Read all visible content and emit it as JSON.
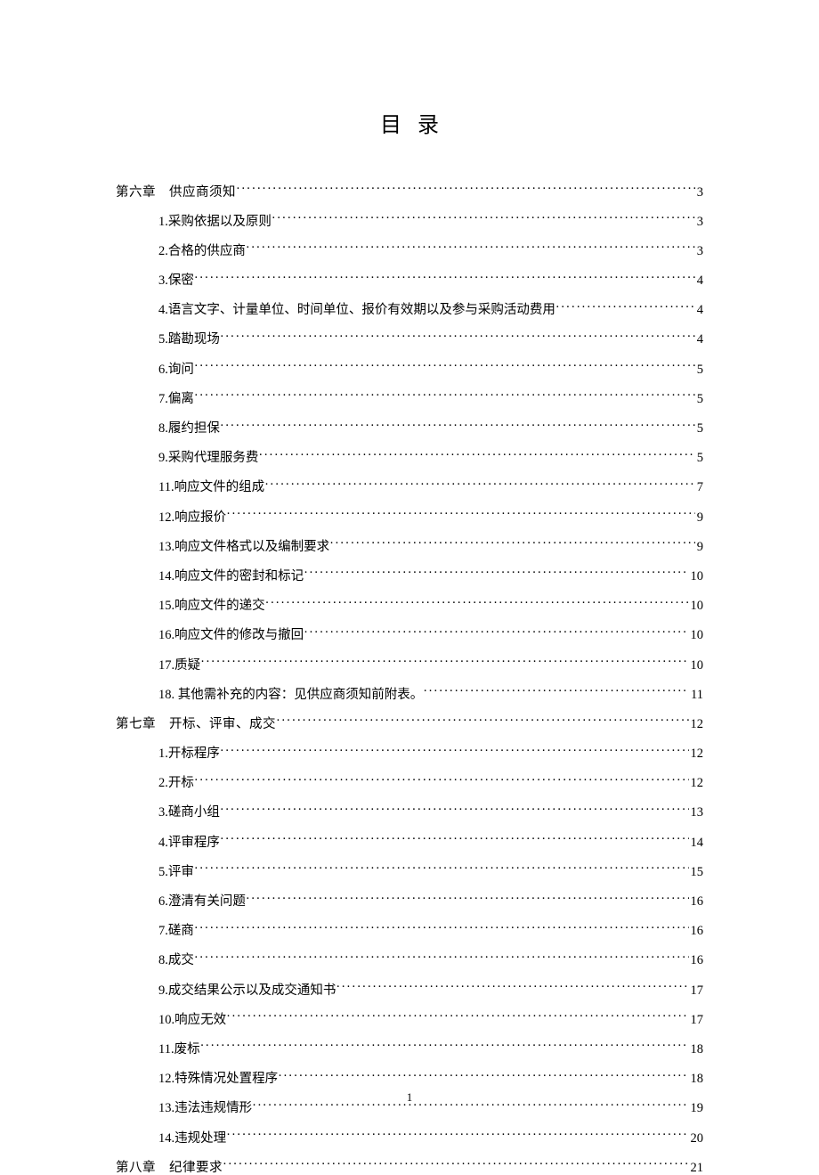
{
  "title": "目录",
  "page_number": "1",
  "entries": [
    {
      "level": "chapter",
      "label_prefix": "第六章",
      "label_text": "供应商须知",
      "page": "3"
    },
    {
      "level": "item",
      "num": "1.",
      "text": "采购依据以及原则",
      "page": "3"
    },
    {
      "level": "item",
      "num": "2.",
      "text": "合格的供应商",
      "page": "3"
    },
    {
      "level": "item",
      "num": "3.",
      "text": "保密",
      "page": "4"
    },
    {
      "level": "item",
      "num": "4.",
      "text": "语言文字、计量单位、时间单位、报价有效期以及参与采购活动费用",
      "page": "4"
    },
    {
      "level": "item",
      "num": "5.",
      "text": "踏勘现场",
      "page": "4"
    },
    {
      "level": "item",
      "num": "6.",
      "text": "询问",
      "page": "5"
    },
    {
      "level": "item",
      "num": "7.",
      "text": "偏离",
      "page": "5"
    },
    {
      "level": "item",
      "num": "8.",
      "text": "履约担保",
      "page": "5"
    },
    {
      "level": "item",
      "num": "9.",
      "text": "采购代理服务费",
      "page": "5"
    },
    {
      "level": "item",
      "num": "11.",
      "text": "响应文件的组成",
      "page": "7"
    },
    {
      "level": "item",
      "num": "12.",
      "text": "响应报价",
      "page": "9"
    },
    {
      "level": "item",
      "num": "13.",
      "text": "响应文件格式以及编制要求",
      "page": "9"
    },
    {
      "level": "item",
      "num": "14.",
      "text": "响应文件的密封和标记",
      "page": "10"
    },
    {
      "level": "item",
      "num": "15.",
      "text": "响应文件的递交",
      "page": "10"
    },
    {
      "level": "item",
      "num": "16.",
      "text": "响应文件的修改与撤回",
      "page": "10"
    },
    {
      "level": "item",
      "num": "17.",
      "text": "质疑",
      "page": "10"
    },
    {
      "level": "item",
      "num": "18.",
      "text": " 其他需补充的内容：见供应商须知前附表。",
      "page": "11"
    },
    {
      "level": "chapter",
      "label_prefix": "第七章",
      "label_text": "开标、评审、成交",
      "page": "12"
    },
    {
      "level": "item",
      "num": "1.",
      "text": "开标程序",
      "page": "12"
    },
    {
      "level": "item",
      "num": "2.",
      "text": "开标",
      "page": "12"
    },
    {
      "level": "item",
      "num": "3.",
      "text": "磋商小组",
      "page": "13"
    },
    {
      "level": "item",
      "num": "4.",
      "text": "评审程序",
      "page": "14"
    },
    {
      "level": "item",
      "num": "5.",
      "text": "评审",
      "page": "15"
    },
    {
      "level": "item",
      "num": "6.",
      "text": "澄清有关问题",
      "page": "16"
    },
    {
      "level": "item",
      "num": "7.",
      "text": "磋商",
      "page": "16"
    },
    {
      "level": "item",
      "num": "8.",
      "text": "成交",
      "page": "16"
    },
    {
      "level": "item",
      "num": "9.",
      "text": "成交结果公示以及成交通知书",
      "page": "17"
    },
    {
      "level": "item",
      "num": "10.",
      "text": "响应无效",
      "page": "17"
    },
    {
      "level": "item",
      "num": "11.",
      "text": "废标",
      "page": "18"
    },
    {
      "level": "item",
      "num": "12.",
      "text": "特殊情况处置程序",
      "page": "18"
    },
    {
      "level": "item",
      "num": "13.",
      "text": "违法违规情形",
      "page": "19"
    },
    {
      "level": "item",
      "num": "14.",
      "text": "违规处理",
      "page": "20"
    },
    {
      "level": "chapter",
      "label_prefix": "第八章",
      "label_text": "纪律要求",
      "page": "21"
    }
  ]
}
